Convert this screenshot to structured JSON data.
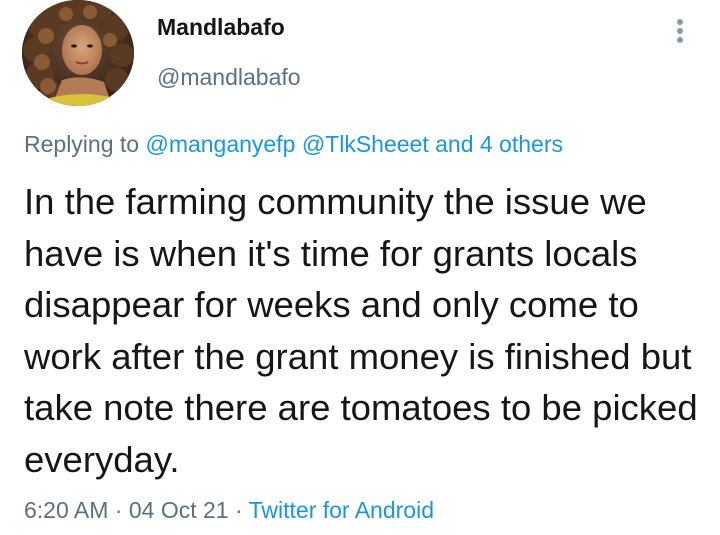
{
  "user": {
    "display_name": "Mandlabafo",
    "handle": "@mandlabafo",
    "avatar_icon": "profile-photo"
  },
  "menu": {
    "icon": "more-vertical-icon"
  },
  "reply": {
    "prefix": "Replying to",
    "mentions": [
      "@manganyefp",
      "@TlkSheeet"
    ],
    "and_word": "and",
    "others": "4 others"
  },
  "tweet": {
    "text": "In the farming community the issue we have is when it's time for grants locals disappear for weeks and only come to work after the grant money is finished but take note there are tomatoes to be picked everyday."
  },
  "meta": {
    "time": "6:20 AM",
    "separator": "·",
    "date": "04 Oct 21",
    "source": "Twitter for Android"
  },
  "colors": {
    "link": "#1b95e0",
    "secondary_text": "#5b7083",
    "primary_text": "#14171a"
  }
}
